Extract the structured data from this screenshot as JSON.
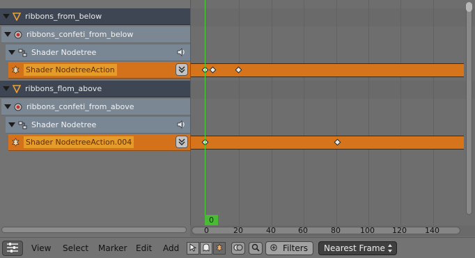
{
  "channels": [
    {
      "type": "object",
      "label": "ribbons_from_below"
    },
    {
      "type": "material",
      "label": "ribbons_confeti_from_below"
    },
    {
      "type": "nodetree",
      "label": "Shader Nodetree"
    },
    {
      "type": "action",
      "label": "Shader NodetreeAction"
    },
    {
      "type": "object",
      "label": "ribbons_flom_above"
    },
    {
      "type": "material",
      "label": "ribbons_confeti_from_above"
    },
    {
      "type": "nodetree",
      "label": "Shader Nodetree"
    },
    {
      "type": "action",
      "label": "Shader NodetreeAction.004"
    }
  ],
  "keyframes": {
    "strip_1": [
      0,
      5,
      21
    ],
    "strip_2": [
      0,
      82
    ]
  },
  "current_frame": "0",
  "ruler_ticks": [
    "0",
    "20",
    "40",
    "60",
    "80",
    "100",
    "120",
    "140"
  ],
  "menu": {
    "view": "View",
    "select": "Select",
    "marker": "Marker",
    "edit": "Edit",
    "add": "Add"
  },
  "filters_label": "Filters",
  "snap_mode": "Nearest Frame",
  "colors": {
    "action_strip": "#d6741c",
    "current_frame": "#4ed13c",
    "object_channel": "#3d4652",
    "material_channel": "#7c8794"
  }
}
